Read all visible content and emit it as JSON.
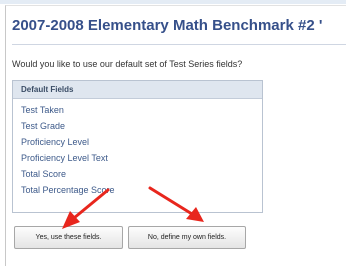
{
  "page": {
    "title": "2007-2008 Elementary Math Benchmark #2 '",
    "question": "Would you like to use our default set of Test Series fields?"
  },
  "fields_box": {
    "header": "Default Fields",
    "items": [
      {
        "label": "Test Taken"
      },
      {
        "label": "Test Grade"
      },
      {
        "label": "Proficiency Level"
      },
      {
        "label": "Proficiency Level Text"
      },
      {
        "label": "Total Score"
      },
      {
        "label": "Total Percentage Score"
      }
    ]
  },
  "buttons": {
    "yes_label": "Yes, use these fields.",
    "no_label": "No, define my own fields."
  },
  "annotations": {
    "arrow_color": "#e8261d"
  }
}
